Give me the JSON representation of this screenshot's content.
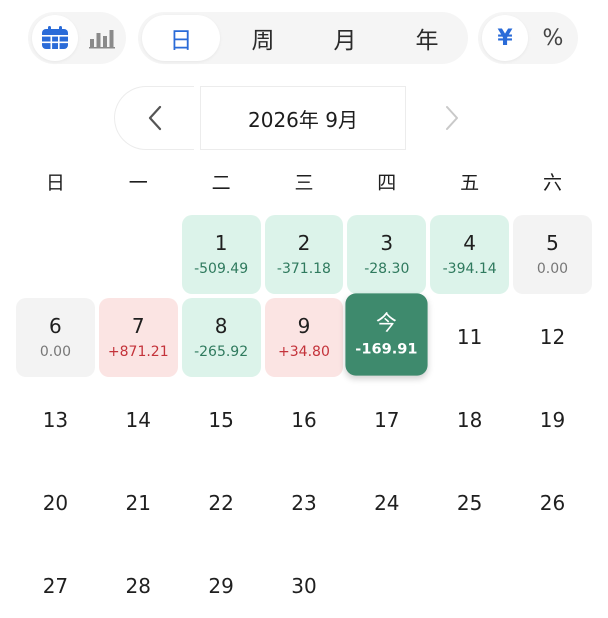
{
  "view_toggle": {
    "calendar_icon": "calendar-grid-icon",
    "chart_icon": "bar-chart-icon",
    "active": "calendar"
  },
  "period_tabs": [
    {
      "label": "日",
      "active": true
    },
    {
      "label": "周",
      "active": false
    },
    {
      "label": "月",
      "active": false
    },
    {
      "label": "年",
      "active": false
    }
  ],
  "unit_toggle": [
    {
      "label": "¥",
      "active": true
    },
    {
      "label": "%",
      "active": false
    }
  ],
  "month_nav": {
    "title": "2026年 9月",
    "prev_icon": "chevron-left-icon",
    "next_icon": "chevron-right-icon"
  },
  "weekdays": [
    "日",
    "一",
    "二",
    "三",
    "四",
    "五",
    "六"
  ],
  "colors": {
    "accent": "#2a6bd8",
    "loss_bg": "#dcf3ea",
    "loss_text": "#2f7a5e",
    "gain_bg": "#fbe4e3",
    "gain_text": "#c4323a",
    "zero_bg": "#f3f3f3",
    "today_bg": "#3e8a6d"
  },
  "calendar": {
    "weeks": [
      [
        null,
        null,
        {
          "day": "1",
          "value": "-509.49",
          "type": "neg"
        },
        {
          "day": "2",
          "value": "-371.18",
          "type": "neg"
        },
        {
          "day": "3",
          "value": "-28.30",
          "type": "neg"
        },
        {
          "day": "4",
          "value": "-394.14",
          "type": "neg"
        },
        {
          "day": "5",
          "value": "0.00",
          "type": "zero"
        }
      ],
      [
        {
          "day": "6",
          "value": "0.00",
          "type": "zero"
        },
        {
          "day": "7",
          "value": "+871.21",
          "type": "pos"
        },
        {
          "day": "8",
          "value": "-265.92",
          "type": "neg"
        },
        {
          "day": "9",
          "value": "+34.80",
          "type": "pos"
        },
        {
          "day": "今",
          "value": "-169.91",
          "type": "today"
        },
        {
          "day": "11",
          "value": "",
          "type": "plain"
        },
        {
          "day": "12",
          "value": "",
          "type": "plain"
        }
      ],
      [
        {
          "day": "13",
          "value": "",
          "type": "plain"
        },
        {
          "day": "14",
          "value": "",
          "type": "plain"
        },
        {
          "day": "15",
          "value": "",
          "type": "plain"
        },
        {
          "day": "16",
          "value": "",
          "type": "plain"
        },
        {
          "day": "17",
          "value": "",
          "type": "plain"
        },
        {
          "day": "18",
          "value": "",
          "type": "plain"
        },
        {
          "day": "19",
          "value": "",
          "type": "plain"
        }
      ],
      [
        {
          "day": "20",
          "value": "",
          "type": "plain"
        },
        {
          "day": "21",
          "value": "",
          "type": "plain"
        },
        {
          "day": "22",
          "value": "",
          "type": "plain"
        },
        {
          "day": "23",
          "value": "",
          "type": "plain"
        },
        {
          "day": "24",
          "value": "",
          "type": "plain"
        },
        {
          "day": "25",
          "value": "",
          "type": "plain"
        },
        {
          "day": "26",
          "value": "",
          "type": "plain"
        }
      ],
      [
        {
          "day": "27",
          "value": "",
          "type": "plain"
        },
        {
          "day": "28",
          "value": "",
          "type": "plain"
        },
        {
          "day": "29",
          "value": "",
          "type": "plain"
        },
        {
          "day": "30",
          "value": "",
          "type": "plain"
        },
        null,
        null,
        null
      ]
    ]
  }
}
